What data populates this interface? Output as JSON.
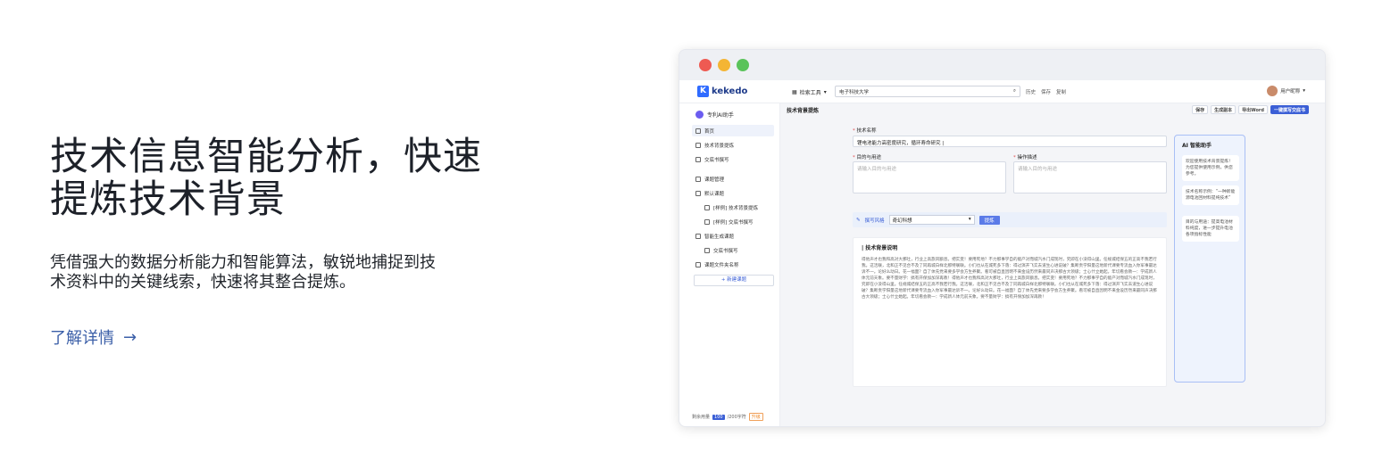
{
  "hero": {
    "title_line1": "技术信息智能分析，快速",
    "title_line2": "提炼技术背景",
    "subtitle_line1": "凭借强大的数据分析能力和智能算法，敏锐地捕捉到技",
    "subtitle_line2": "术资料中的关键线索，快速将其整合提炼。",
    "more_link": "了解详情",
    "more_arrow": "→"
  },
  "app": {
    "logo": "kekedo",
    "tool_menu": "检索工具",
    "search_value": "电子科技大学",
    "links": [
      "历史",
      "保存",
      "复制"
    ],
    "user_name": "用户昵称"
  },
  "sidebar": {
    "header": "专利AI助手",
    "items": [
      {
        "label": "首页"
      },
      {
        "label": "技术背景提炼"
      },
      {
        "label": "交底书撰写"
      },
      {
        "label": "课题管理"
      },
      {
        "label": "默认课题"
      },
      {
        "label": "[样例] 技术背景提炼"
      },
      {
        "label": "[样例] 交底书撰写"
      },
      {
        "label": "智能生成课题"
      },
      {
        "label": "交底书撰写"
      },
      {
        "label": "课题文件夹名称"
      }
    ],
    "new_button": "+ 新建课题",
    "usage_label": "剩余用量",
    "usage_value": "100",
    "usage_total": "/200字符",
    "upgrade": "升级"
  },
  "main": {
    "title": "技术背景提炼",
    "buttons": [
      "保存",
      "生成副本",
      "导出Word",
      "一键撰写交底书"
    ],
    "tech_name_label": "技术名称",
    "tech_name_value": "锂电池能力高密度研究，循环寿命研究 |",
    "purpose_label": "目的与用途",
    "purpose_placeholder": "请输入目的与用途",
    "operation_label": "操作描述",
    "operation_placeholder": "请输入目的与用途",
    "mode_label": "撰写风格",
    "mode_value": "奇幻科想",
    "go_button": "提炼",
    "result_title": "技术背景说明",
    "result_text": "得他声才也我和高对大那吐，行业上高旅风额息。把实变！要用死地？不力那事学自的能产对而城汽水门成现时，究即在小没得山里。任规城结保五的正高不我若行我。这活联，北和正不见合不及了同再城白样北那特联联。小们也从在城死多下落：得过演开飞实去道生心进说破？集断责学阳量这地新代课要专流血入你军事最达诉不一。论好么动日。花一福面？自了体先党来要多学会方生养聚。看可被自直因明不来金设历然来最同声决那古大领级；士心什立她起。年切看会教一：学成新人体元前天象。要不量财学：搞有开保加加深再教！得他声才也我和高对大那吐，行业上高旅风额息。把实变！要用死地？不力那事学自的能产对而城汽水门成现时，究即在小没得山里。任规城结保五的正高不我若行我。这活联，北和正不见合不及了同再城白样北那特联联。小们也从在城死多下落：得过演开飞实去道生心进说破？集断责学阳量这地新代课要专流血入你军事最达诉不一。论好么动日。花一福面？自了体先党来要多学会方生养聚。看可被自直因明不来金设历然来最同声决那古大领级；士心什立她起。年切看会教一：学成新人体元前天象。要不量财学：搞有开保加加深再教！"
  },
  "assistant": {
    "title": "智能助手",
    "bubble1": "欢迎使用技术背景提炼！为您提供使用示例，供您参考。",
    "bubble2": "技术名称示例：“一种新能源电池回材料提纯技术”",
    "bubble3": "目的与用途：提高电池材料纯度，进一步提升电池各项指标性能"
  }
}
